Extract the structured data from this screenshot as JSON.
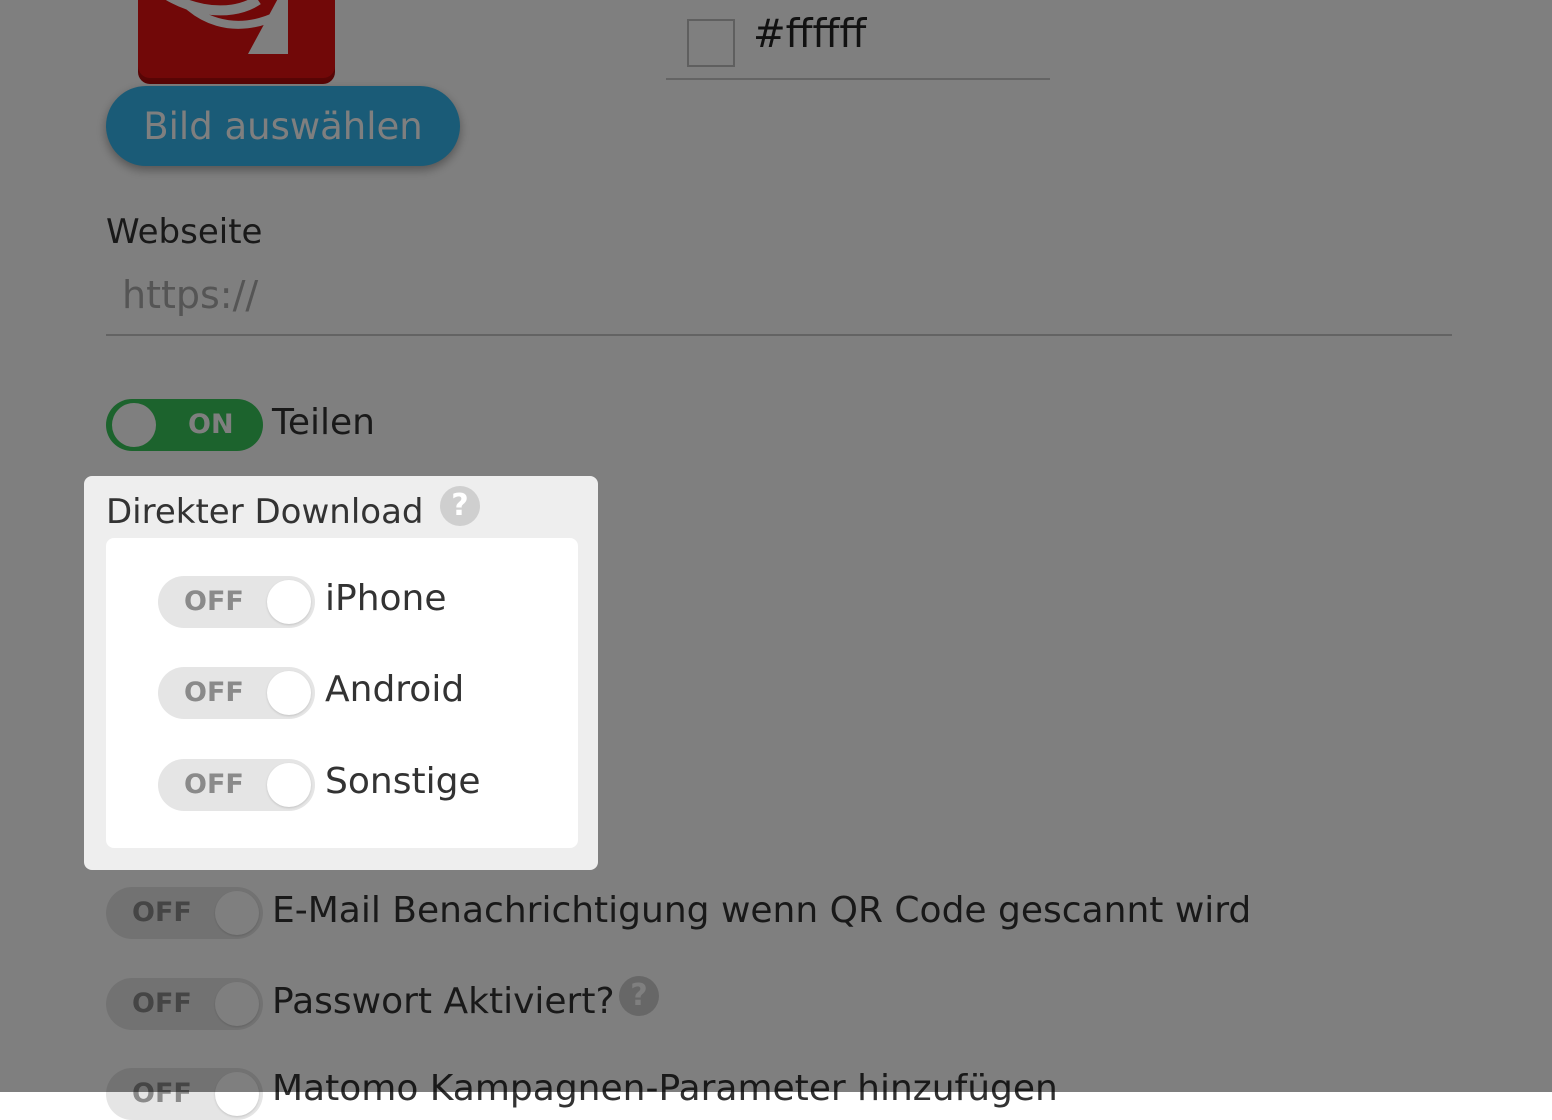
{
  "image_upload": {
    "button_label": "Bild auswählen"
  },
  "color_field": {
    "value": "#ffffff"
  },
  "website": {
    "label": "Webseite",
    "placeholder": "https://",
    "value": ""
  },
  "share": {
    "state": "ON",
    "label": "Teilen"
  },
  "direct_download": {
    "title": "Direkter Download",
    "help_icon": "?",
    "items": [
      {
        "state": "OFF",
        "label": "iPhone"
      },
      {
        "state": "OFF",
        "label": "Android"
      },
      {
        "state": "OFF",
        "label": "Sonstige"
      }
    ]
  },
  "email_notification": {
    "state": "OFF",
    "label": "E-Mail Benachrichtigung wenn QR Code gescannt wird"
  },
  "password": {
    "state": "OFF",
    "label": "Passwort Aktiviert?",
    "help_icon": "?"
  },
  "matomo": {
    "state": "OFF",
    "label": "Matomo Kampagnen-Parameter hinzufügen"
  },
  "colors": {
    "accent_button": "#35b7ee",
    "toggle_on": "#38c75a",
    "toggle_off": "#e5e5e5",
    "logo_red": "#e31010"
  }
}
